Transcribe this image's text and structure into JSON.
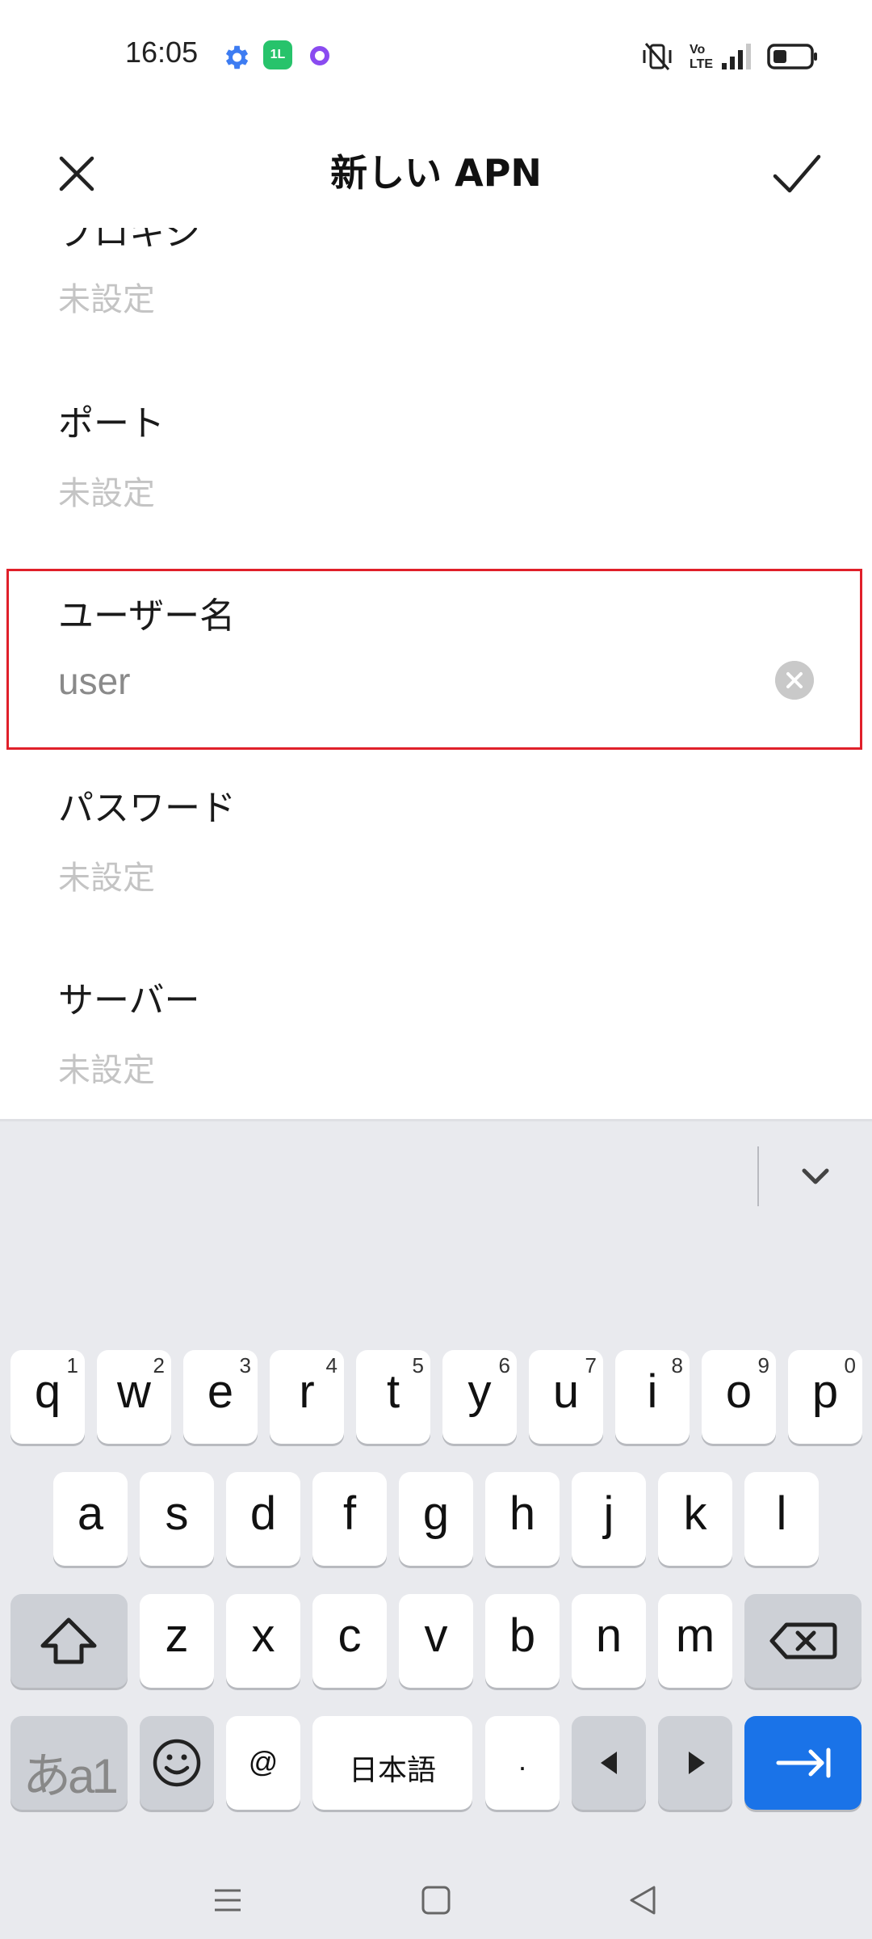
{
  "status_bar": {
    "time": "16:05",
    "app_icon_text": "1L",
    "left_icons": [
      "gear-icon",
      "app-icon",
      "circle-icon"
    ],
    "right_icons": [
      "vibrate-off-icon",
      "volte-icon",
      "signal-icon",
      "battery-icon"
    ]
  },
  "app_bar": {
    "title": "新しい APN",
    "close_icon": "close-icon",
    "confirm_icon": "check-icon"
  },
  "fields": [
    {
      "label": "プロキシ",
      "value": "未設定"
    },
    {
      "label": "ポート",
      "value": "未設定"
    },
    {
      "label": "ユーザー名",
      "value": "user"
    },
    {
      "label": "パスワード",
      "value": "未設定"
    },
    {
      "label": "サーバー",
      "value": "未設定"
    }
  ],
  "keyboard": {
    "row1": [
      {
        "key": "q",
        "hint": "1"
      },
      {
        "key": "w",
        "hint": "2"
      },
      {
        "key": "e",
        "hint": "3"
      },
      {
        "key": "r",
        "hint": "4"
      },
      {
        "key": "t",
        "hint": "5"
      },
      {
        "key": "y",
        "hint": "6"
      },
      {
        "key": "u",
        "hint": "7"
      },
      {
        "key": "i",
        "hint": "8"
      },
      {
        "key": "o",
        "hint": "9"
      },
      {
        "key": "p",
        "hint": "0"
      }
    ],
    "row2": [
      "a",
      "s",
      "d",
      "f",
      "g",
      "h",
      "j",
      "k",
      "l"
    ],
    "row3": [
      "z",
      "x",
      "c",
      "v",
      "b",
      "n",
      "m"
    ],
    "mode_key": "あa1",
    "at_key": "@",
    "space_key": "日本語",
    "period_key": ".",
    "colors": {
      "enter": "#1a73e8",
      "background": "#e9eaee",
      "highlight": "#e0202a"
    }
  }
}
